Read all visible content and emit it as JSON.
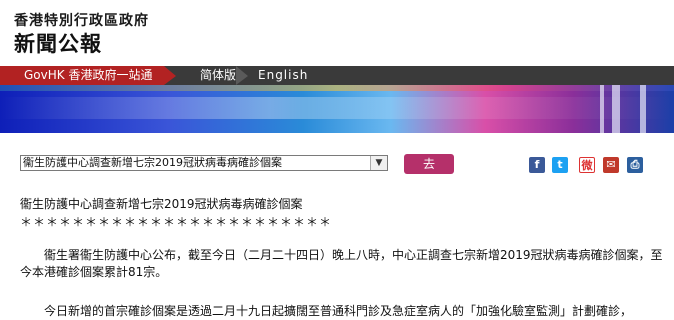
{
  "header": {
    "gov_name": "香港特別行政區政府",
    "press_title": "新聞公報"
  },
  "nav": {
    "home_label": "GovHK 香港政府一站通",
    "simplified_label": "简体版",
    "english_label": "English"
  },
  "controls": {
    "select_value": "衞生防護中心調查新增七宗2019冠狀病毒病確診個案",
    "go_label": "去"
  },
  "share": {
    "facebook": "f",
    "twitter": "t",
    "weibo": "微",
    "email": "✉",
    "print": "⎙"
  },
  "article": {
    "title": "衞生防護中心調查新增七宗2019冠狀病毒病確診個案",
    "separator": "＊＊＊＊＊＊＊＊＊＊＊＊＊＊＊＊＊＊＊＊＊＊＊＊",
    "para1": "衞生署衞生防護中心公布，截至今日（二月二十四日）晚上八時，中心正調查七宗新增2019冠狀病毒病確診個案，至今本港確診個案累計81宗。",
    "para2": "今日新增的首宗確診個案是透過二月十九日起擴闊至普通科門診及急症室病人的「加強化驗室監測」計劃確診，"
  }
}
